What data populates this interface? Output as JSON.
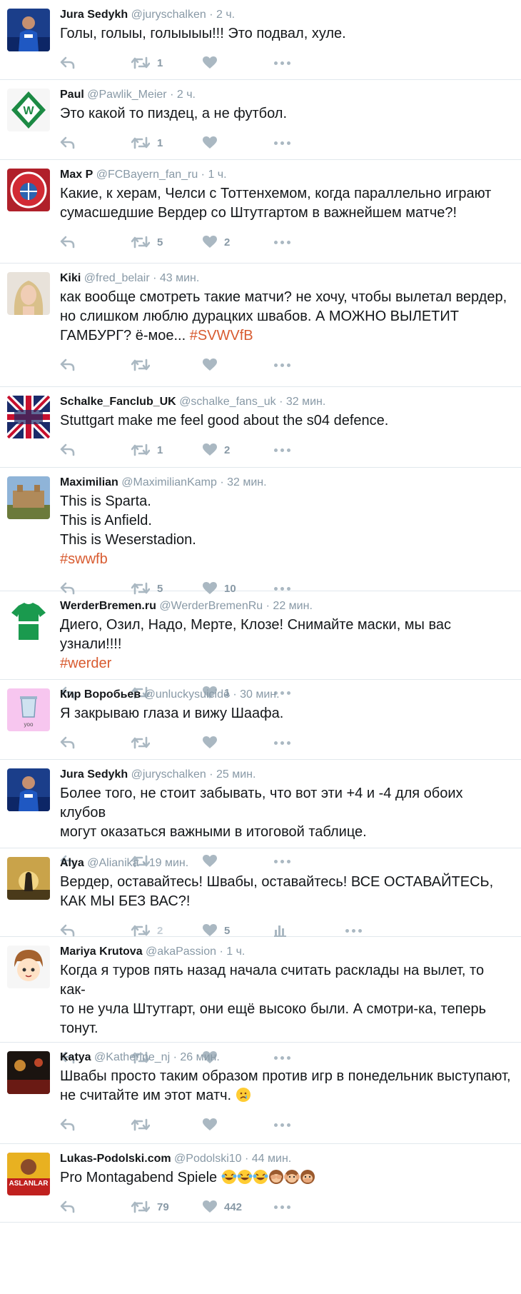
{
  "tweets": [
    {
      "name": "Jura Sedykh",
      "handle": "@juryschalken",
      "time": "2 ч.",
      "lines": [
        "Голы, голыы, голыыыы!!! Это подвал, хуле."
      ],
      "retweets": "1",
      "likes": "",
      "avatar": "schalke"
    },
    {
      "name": "Paul",
      "handle": "@Pawlik_Meier",
      "time": "2 ч.",
      "lines": [
        "Это какой то пиздец, а не футбол."
      ],
      "retweets": "1",
      "likes": "",
      "avatar": "werder-logo"
    },
    {
      "name": "Max P",
      "handle": "@FCBayern_fan_ru",
      "time": "1 ч.",
      "lines": [
        "Какие, к херам, Челси с Тоттенхемом, когда параллельно играют",
        "сумасшедшие Вердер со Штутгартом в важнейшем матче?!"
      ],
      "retweets": "5",
      "likes": "2",
      "avatar": "bayern"
    },
    {
      "name": "Kiki",
      "handle": "@fred_belair",
      "time": "43 мин.",
      "lines": [
        "как вообще смотреть такие матчи? не хочу, чтобы вылетал вердер,",
        "но слишком люблю дурацких швабов. А МОЖНО ВЫЛЕТИТ"
      ],
      "last_line_text": "ГАМБУРГ? ё-мое... ",
      "hashtag": "#SVWVfB",
      "retweets": "",
      "likes": "",
      "avatar": "girl"
    },
    {
      "name": "Schalke_Fanclub_UK",
      "handle": "@schalke_fans_uk",
      "time": "32 мин.",
      "lines": [
        "Stuttgart make me feel good about the s04 defence."
      ],
      "retweets": "1",
      "likes": "2",
      "avatar": "uk-flag"
    },
    {
      "name": "Maximilian",
      "handle": "@MaximilianKamp",
      "time": "32 мин.",
      "lines": [
        "This is Sparta.",
        "This is Anfield.",
        "This is Weserstadion."
      ],
      "hashtag": "#swwfb",
      "retweets": "5",
      "likes": "10",
      "avatar": "castle"
    },
    {
      "name": "WerderBremen.ru",
      "handle": "@WerderBremenRu",
      "time": "22 мин.",
      "lines": [
        "Диего, Озил, Нaдо, Мерте, Клозе! Снимайте маски, мы вас узнали!!!!"
      ],
      "hashtag": "#werder",
      "retweets": "",
      "likes": "1",
      "avatar": "jersey"
    },
    {
      "name": "Кир Воробьев",
      "handle": "@unluckysuicide",
      "time": "30 мин.",
      "lines": [
        "Я закрываю глаза и вижу Шаафа."
      ],
      "retweets": "",
      "likes": "",
      "avatar": "trash"
    },
    {
      "name": "Jura Sedykh",
      "handle": "@juryschalken",
      "time": "25 мин.",
      "lines": [
        "Более того, не стоит забывать, что вот эти +4 и -4 для обоих клубов",
        "могут оказаться важными в итоговой таблице."
      ],
      "retweets": "",
      "likes": "",
      "avatar": "schalke"
    },
    {
      "name": "Alya",
      "handle": "@Alianika",
      "time": "19 мин.",
      "lines": [
        "Вердер, оставайтесь! Швабы, оставайтесь! ВСЕ ОСТАВАЙТЕСЬ,",
        "КАК МЫ БЕЗ ВАС?!"
      ],
      "retweets": "2",
      "likes": "5",
      "avatar": "sunset",
      "stats": true
    },
    {
      "name": "Mariya Krutova",
      "handle": "@akaPassion",
      "time": "1 ч.",
      "lines": [
        "Когда я туров пять назад начала считать расклады на вылет, то как-",
        "то не учла Штутгарт, они ещё высоко были. А смотри-ка, теперь",
        "тонут."
      ],
      "retweets": "",
      "likes": "",
      "avatar": "anime"
    },
    {
      "name": "Katya",
      "handle": "@Katherine_nj",
      "time": "26 мин.",
      "lines": [
        "Швабы просто таким образом против игр в понедельник выступают,"
      ],
      "last_line_text": "не считайте им этот матч. ",
      "emoji_end": "crying-face",
      "retweets": "",
      "likes": "",
      "avatar": "concert"
    },
    {
      "name": "Lukas-Podolski.com",
      "handle": "@Podolski10",
      "time": "44 мин.",
      "lines": [],
      "last_line_text": "Pro Montagabend Spiele ",
      "emojis": [
        "laughing-tears",
        "laughing-tears",
        "laughing-tears",
        "see-no-evil-monkey",
        "hear-no-evil-monkey",
        "speak-no-evil-monkey"
      ],
      "retweets": "79",
      "likes": "442",
      "avatar": "aslanlar",
      "avatar_text": "ASLANLAR"
    }
  ],
  "colors": {
    "hashtag": "#d85b30",
    "icon": "#aab8c2",
    "name": "#14171a",
    "meta": "#8899a6"
  }
}
